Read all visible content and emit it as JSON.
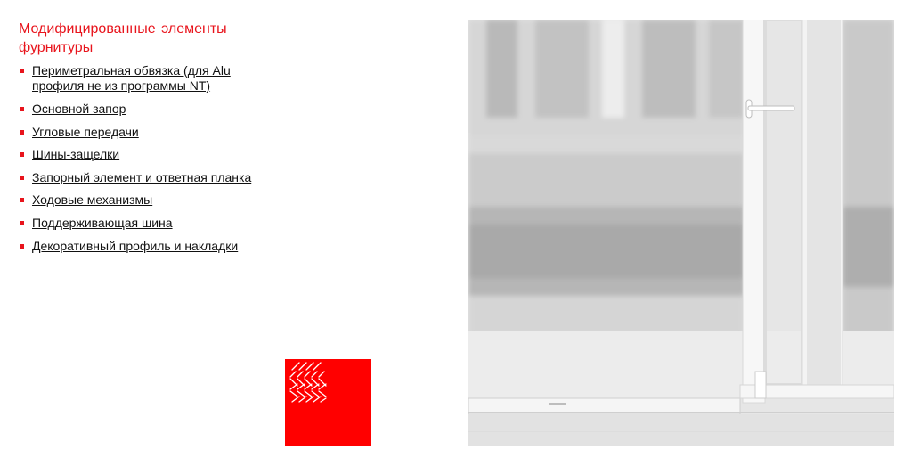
{
  "section_title": "Модифицированные  элементы фурнитуры",
  "items": [
    {
      "label": "Периметральная обвязка (для Alu профиля не из программы NT)"
    },
    {
      "label": "Основной запор"
    },
    {
      "label": "Угловые передачи"
    },
    {
      "label": "Шины-защелки"
    },
    {
      "label": "Запорный элемент и ответная планка"
    },
    {
      "label": "Ходовые механизмы"
    },
    {
      "label": "Поддерживающая шина"
    },
    {
      "label": "Декоративный профиль и накладки"
    }
  ],
  "colors": {
    "accent": "#e8141c",
    "logo": "#ff0000"
  },
  "icons": {
    "logo": "hatch-pattern-logo",
    "bullet": "square-bullet-icon"
  }
}
